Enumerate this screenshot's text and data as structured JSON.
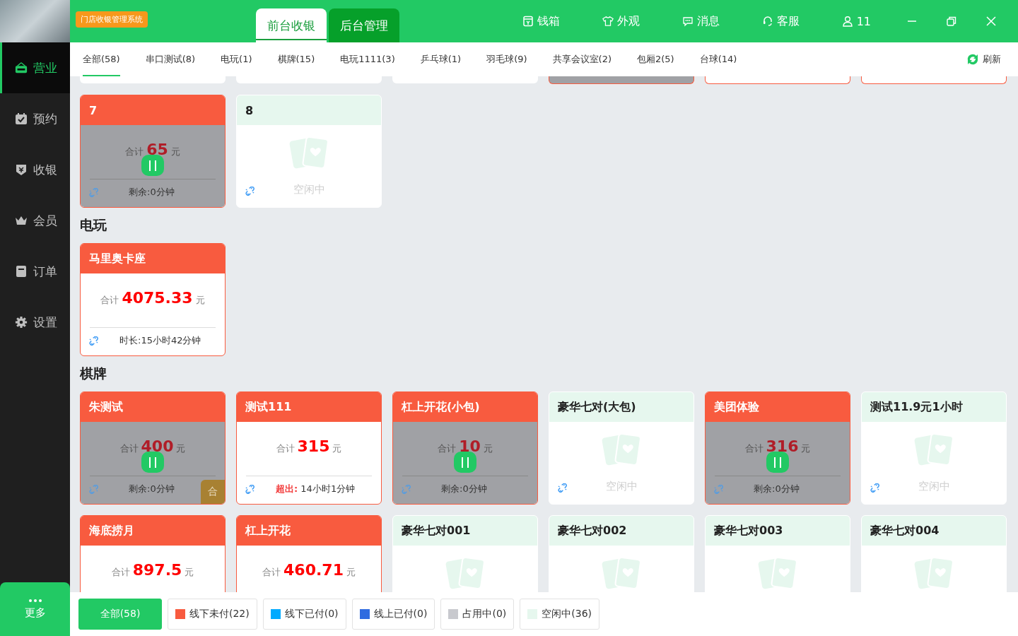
{
  "app_badge": "门店收银管理系统",
  "mode_tabs": [
    {
      "label": "前台收银",
      "selected": true
    },
    {
      "label": "后台管理",
      "selected": false
    }
  ],
  "toolbar": [
    {
      "kind": "cashbox",
      "label": "钱箱"
    },
    {
      "kind": "shirt",
      "label": "外观"
    },
    {
      "kind": "message",
      "label": "消息"
    },
    {
      "kind": "headset",
      "label": "客服"
    },
    {
      "kind": "user",
      "label": "11"
    }
  ],
  "sidebar": {
    "items": [
      {
        "kind": "open",
        "label": "营业",
        "selected": true
      },
      {
        "kind": "calendar",
        "label": "预约",
        "selected": false
      },
      {
        "kind": "cash",
        "label": "收银",
        "selected": false
      },
      {
        "kind": "crown",
        "label": "会员",
        "selected": false
      },
      {
        "kind": "order",
        "label": "订单",
        "selected": false
      },
      {
        "kind": "gear",
        "label": "设置",
        "selected": false
      }
    ],
    "more": "更多"
  },
  "categories": [
    {
      "label": "全部(58)",
      "selected": true
    },
    {
      "label": "串口测试(8)",
      "selected": false
    },
    {
      "label": "电玩(1)",
      "selected": false
    },
    {
      "label": "棋牌(15)",
      "selected": false
    },
    {
      "label": "电玩1111(3)",
      "selected": false
    },
    {
      "label": "乒乓球(1)",
      "selected": false
    },
    {
      "label": "羽毛球(9)",
      "selected": false
    },
    {
      "label": "共享会议室(2)",
      "selected": false
    },
    {
      "label": "包厢2(5)",
      "selected": false
    },
    {
      "label": "台球(14)",
      "selected": false
    }
  ],
  "refresh": "刷新",
  "sections": [
    {
      "stubs": [
        {
          "kind": "idle"
        },
        {
          "kind": "idle"
        },
        {
          "kind": "idle"
        },
        {
          "kind": "paused"
        },
        {
          "kind": "unpaid"
        },
        {
          "kind": "unpaid"
        }
      ],
      "cards": [
        {
          "name": "7",
          "kind": "paused",
          "total_label": "合计",
          "total": "65",
          "unit": "元",
          "footer": "剩余:0分钟"
        },
        {
          "name": "8",
          "kind": "idle",
          "idle_text": "空闲中"
        }
      ]
    },
    {
      "title": "电玩",
      "cards": [
        {
          "name": "马里奥卡座",
          "kind": "unpaid",
          "total_label": "合计",
          "total": "4075.33",
          "unit": "元",
          "footer": "时长:15小时42分钟"
        }
      ]
    },
    {
      "title": "棋牌",
      "cards": [
        {
          "name": "朱测试",
          "kind": "paused",
          "total_label": "合计",
          "total": "400",
          "unit": "元",
          "footer": "剩余:0分钟",
          "badge": "合"
        },
        {
          "name": "测试111",
          "kind": "unpaid",
          "total_label": "合计",
          "total": "315",
          "unit": "元",
          "footer_alert": "超出:",
          "footer": "14小时1分钟"
        },
        {
          "name": "杠上开花(小包)",
          "kind": "paused",
          "total_label": "合计",
          "total": "10",
          "unit": "元",
          "footer": "剩余:0分钟"
        },
        {
          "name": "豪华七对(大包)",
          "kind": "idle",
          "idle_text": "空闲中"
        },
        {
          "name": "美团体验",
          "kind": "paused",
          "total_label": "合计",
          "total": "316",
          "unit": "元",
          "footer": "剩余:0分钟"
        },
        {
          "name": "测试11.9元1小时",
          "kind": "idle",
          "idle_text": "空闲中"
        },
        {
          "name": "海底捞月",
          "kind": "unpaid",
          "total_label": "合计",
          "total": "897.5",
          "unit": "元"
        },
        {
          "name": "杠上开花",
          "kind": "unpaid",
          "total_label": "合计",
          "total": "460.71",
          "unit": "元"
        },
        {
          "name": "豪华七对001",
          "kind": "idle"
        },
        {
          "name": "豪华七对002",
          "kind": "idle"
        },
        {
          "name": "豪华七对003",
          "kind": "idle"
        },
        {
          "name": "豪华七对004",
          "kind": "idle"
        }
      ]
    }
  ],
  "filters": [
    {
      "label": "全部(58)",
      "selected": true
    },
    {
      "label": "线下未付(22)",
      "selected": false,
      "color": "#f85b3f"
    },
    {
      "label": "线下已付(0)",
      "selected": false,
      "color": "#00aaff"
    },
    {
      "label": "线上已付(0)",
      "selected": false,
      "color": "#2f6be0"
    },
    {
      "label": "占用中(0)",
      "selected": false,
      "color": "#c8c9ce"
    },
    {
      "label": "空闲中(36)",
      "selected": false,
      "color": "#e6f7ee"
    }
  ]
}
